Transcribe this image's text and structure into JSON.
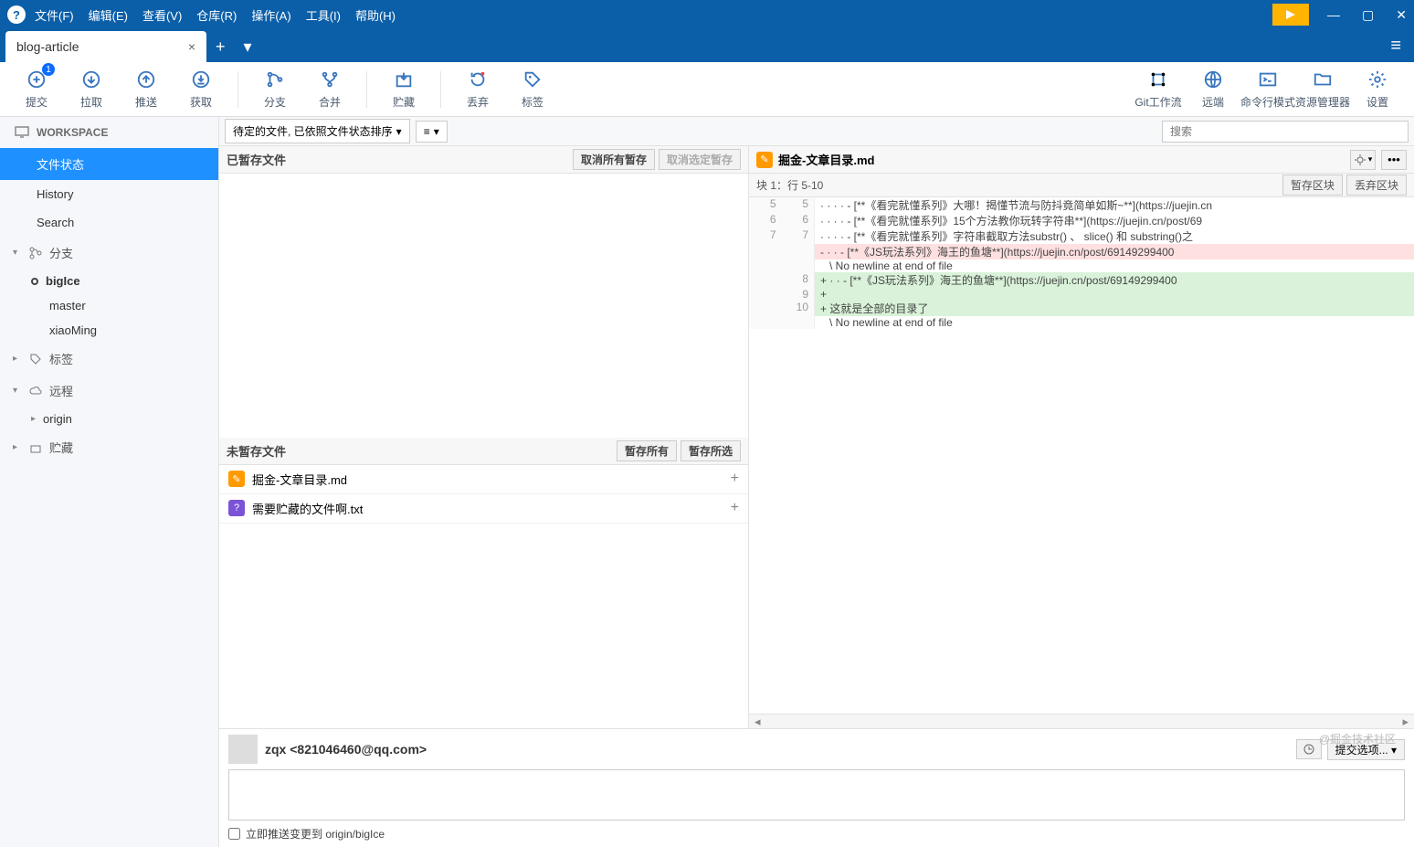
{
  "menu": {
    "file": "文件(F)",
    "edit": "编辑(E)",
    "view": "查看(V)",
    "repo": "仓库(R)",
    "action": "操作(A)",
    "tool": "工具(I)",
    "help": "帮助(H)"
  },
  "tab": {
    "name": "blog-article"
  },
  "toolbar": {
    "commit": "提交",
    "commit_badge": "1",
    "pull": "拉取",
    "push": "推送",
    "fetch": "获取",
    "branch": "分支",
    "merge": "合并",
    "stash": "贮藏",
    "discard": "丢弃",
    "tag": "标签",
    "gitflow": "Git工作流",
    "remote": "远端",
    "cmdline": "命令行模式",
    "resmgr": "资源管理器",
    "settings": "设置"
  },
  "sidebar": {
    "workspace": "WORKSPACE",
    "ws_items": [
      "文件状态",
      "History",
      "Search"
    ],
    "branch": "分支",
    "branches": [
      "bigIce",
      "master",
      "xiaoMing"
    ],
    "tag": "标签",
    "remote": "远程",
    "remote_items": [
      "origin"
    ],
    "stash": "贮藏"
  },
  "filter": {
    "sort": "待定的文件, 已依照文件状态排序",
    "search_ph": "搜索"
  },
  "staged": {
    "title": "已暂存文件",
    "unstage_all": "取消所有暂存",
    "unstage_sel": "取消选定暂存"
  },
  "unstaged": {
    "title": "未暂存文件",
    "stage_all": "暂存所有",
    "stage_sel": "暂存所选",
    "files": [
      {
        "name": "掘金-文章目录.md",
        "type": "mod"
      },
      {
        "name": "需要贮藏的文件啊.txt",
        "type": "unk"
      }
    ]
  },
  "diff": {
    "file": "掘金-文章目录.md",
    "hunk": "块 1：行 5-10",
    "stage_hunk": "暂存区块",
    "discard_hunk": "丢弃区块",
    "lines": [
      {
        "old": "5",
        "new": "5",
        "t": "ctx",
        "text": "· · · · - [**《看完就懂系列》大哪！揭懂节流与防抖竟简单如斯~**](https://juejin.cn"
      },
      {
        "old": "6",
        "new": "6",
        "t": "ctx",
        "text": "· · · · - [**《看完就懂系列》15个方法教你玩转字符串**](https://juejin.cn/post/69"
      },
      {
        "old": "7",
        "new": "7",
        "t": "ctx",
        "text": "· · · · - [**《看完就懂系列》字符串截取方法substr() 、 slice() 和 substring()之"
      },
      {
        "old": "",
        "new": "",
        "t": "del",
        "text": "- · · - [**《JS玩法系列》海王的鱼塘**](https://juejin.cn/post/69149299400"
      },
      {
        "old": "",
        "new": "",
        "t": "ctx",
        "text": "   \\ No newline at end of file"
      },
      {
        "old": "",
        "new": "8",
        "t": "add",
        "text": "+ · · - [**《JS玩法系列》海王的鱼塘**](https://juejin.cn/post/69149299400"
      },
      {
        "old": "",
        "new": "9",
        "t": "add",
        "text": "+ "
      },
      {
        "old": "",
        "new": "10",
        "t": "add",
        "text": "+ 这就是全部的目录了"
      },
      {
        "old": "",
        "new": "",
        "t": "ctx",
        "text": "   \\ No newline at end of file"
      }
    ]
  },
  "commit": {
    "author": "zqx <821046460@qq.com>",
    "options": "提交选项...",
    "push_after": "立即推送变更到 origin/bigIce"
  },
  "watermark": "@掘金技术社区"
}
